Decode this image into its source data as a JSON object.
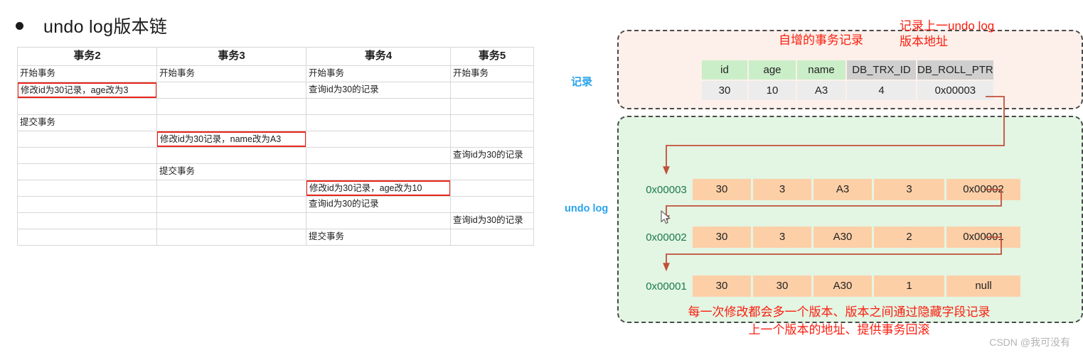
{
  "heading": {
    "bullet": "bullet-dot",
    "text": "undo log版本链"
  },
  "txn_table": {
    "headers": [
      "事务2",
      "事务3",
      "事务4",
      "事务5"
    ],
    "rows": [
      [
        {
          "text": "开始事务",
          "highlight": false
        },
        {
          "text": "开始事务",
          "highlight": false
        },
        {
          "text": "开始事务",
          "highlight": false
        },
        {
          "text": "开始事务",
          "highlight": false
        }
      ],
      [
        {
          "text": "修改id为30记录，age改为3",
          "highlight": true
        },
        {
          "text": "",
          "highlight": false
        },
        {
          "text": "查询id为30的记录",
          "highlight": false
        },
        {
          "text": "",
          "highlight": false
        }
      ],
      [
        {
          "text": "",
          "highlight": false
        },
        {
          "text": "",
          "highlight": false
        },
        {
          "text": "",
          "highlight": false
        },
        {
          "text": "",
          "highlight": false
        }
      ],
      [
        {
          "text": "提交事务",
          "highlight": false
        },
        {
          "text": "",
          "highlight": false
        },
        {
          "text": "",
          "highlight": false
        },
        {
          "text": "",
          "highlight": false
        }
      ],
      [
        {
          "text": "",
          "highlight": false
        },
        {
          "text": "修改id为30记录，name改为A3",
          "highlight": true
        },
        {
          "text": "",
          "highlight": false
        },
        {
          "text": "",
          "highlight": false
        }
      ],
      [
        {
          "text": "",
          "highlight": false
        },
        {
          "text": "",
          "highlight": false
        },
        {
          "text": "",
          "highlight": false
        },
        {
          "text": "查询id为30的记录",
          "highlight": false
        }
      ],
      [
        {
          "text": "",
          "highlight": false
        },
        {
          "text": "提交事务",
          "highlight": false
        },
        {
          "text": "",
          "highlight": false
        },
        {
          "text": "",
          "highlight": false
        }
      ],
      [
        {
          "text": "",
          "highlight": false
        },
        {
          "text": "",
          "highlight": false
        },
        {
          "text": "修改id为30记录，age改为10",
          "highlight": true
        },
        {
          "text": "",
          "highlight": false
        }
      ],
      [
        {
          "text": "",
          "highlight": false
        },
        {
          "text": "",
          "highlight": false
        },
        {
          "text": "查询id为30的记录",
          "highlight": false
        },
        {
          "text": "",
          "highlight": false
        }
      ],
      [
        {
          "text": "",
          "highlight": false
        },
        {
          "text": "",
          "highlight": false
        },
        {
          "text": "",
          "highlight": false
        },
        {
          "text": "查询id为30的记录",
          "highlight": false
        }
      ],
      [
        {
          "text": "",
          "highlight": false
        },
        {
          "text": "",
          "highlight": false
        },
        {
          "text": "提交事务",
          "highlight": false
        },
        {
          "text": "",
          "highlight": false
        }
      ]
    ]
  },
  "diagram": {
    "labels": {
      "record": "记录",
      "undolog": "undo log"
    },
    "annotations": {
      "trx_id": "自增的事务记录",
      "roll_ptr_line1": "记录上一undo log",
      "roll_ptr_line2": "版本地址",
      "bottom_line1": "每一次修改都会多一个版本、版本之间通过隐藏字段记录",
      "bottom_line2": "上一个版本的地址、提供事务回滚"
    },
    "record_table": {
      "headers": [
        "id",
        "age",
        "name",
        "DB_TRX_ID",
        "DB_ROLL_PTR"
      ],
      "row": [
        "30",
        "10",
        "A3",
        "4",
        "0x00003"
      ]
    },
    "undo_rows": [
      {
        "addr": "0x00003",
        "cells": [
          "30",
          "3",
          "A3",
          "3",
          "0x00002"
        ]
      },
      {
        "addr": "0x00002",
        "cells": [
          "30",
          "3",
          "A30",
          "2",
          "0x00001"
        ]
      },
      {
        "addr": "0x00001",
        "cells": [
          "30",
          "30",
          "A30",
          "1",
          "null"
        ]
      }
    ],
    "colors": {
      "label_blue": "#29a3ef",
      "annotation_red": "#fa1e0f",
      "highlight_red": "#e8251a",
      "record_bg": "#fdf0ea",
      "undolog_bg": "#e3f5e3",
      "undo_cell": "#fccfa7",
      "header_green": "#caeec8",
      "header_grey": "#cfcfcf",
      "addr_green": "#1a7a4e",
      "connector": "#c0503a"
    }
  },
  "watermark": "CSDN @我可没有"
}
